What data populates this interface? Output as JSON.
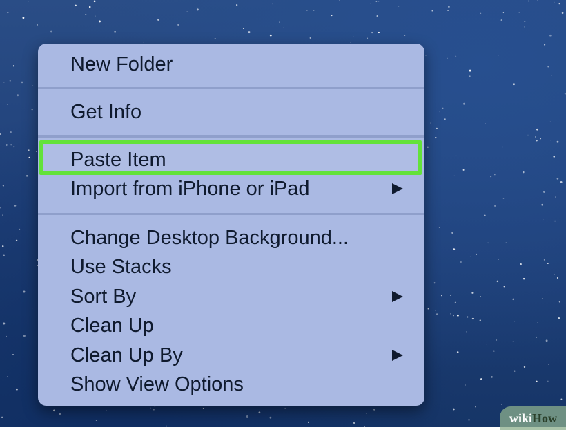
{
  "menu": {
    "items": [
      {
        "label": "New Folder",
        "submenu": false
      },
      {
        "label": "Get Info",
        "submenu": false
      },
      {
        "label": "Paste Item",
        "submenu": false,
        "highlighted": true
      },
      {
        "label": "Import from iPhone or iPad",
        "submenu": true
      },
      {
        "label": "Change Desktop Background...",
        "submenu": false
      },
      {
        "label": "Use Stacks",
        "submenu": false
      },
      {
        "label": "Sort By",
        "submenu": true
      },
      {
        "label": "Clean Up",
        "submenu": false
      },
      {
        "label": "Clean Up By",
        "submenu": true
      },
      {
        "label": "Show View Options",
        "submenu": false
      }
    ]
  },
  "highlight_color": "#63e23a",
  "menu_background": "#aab9e3",
  "watermark": {
    "part1": "wiki",
    "part2": "How"
  }
}
